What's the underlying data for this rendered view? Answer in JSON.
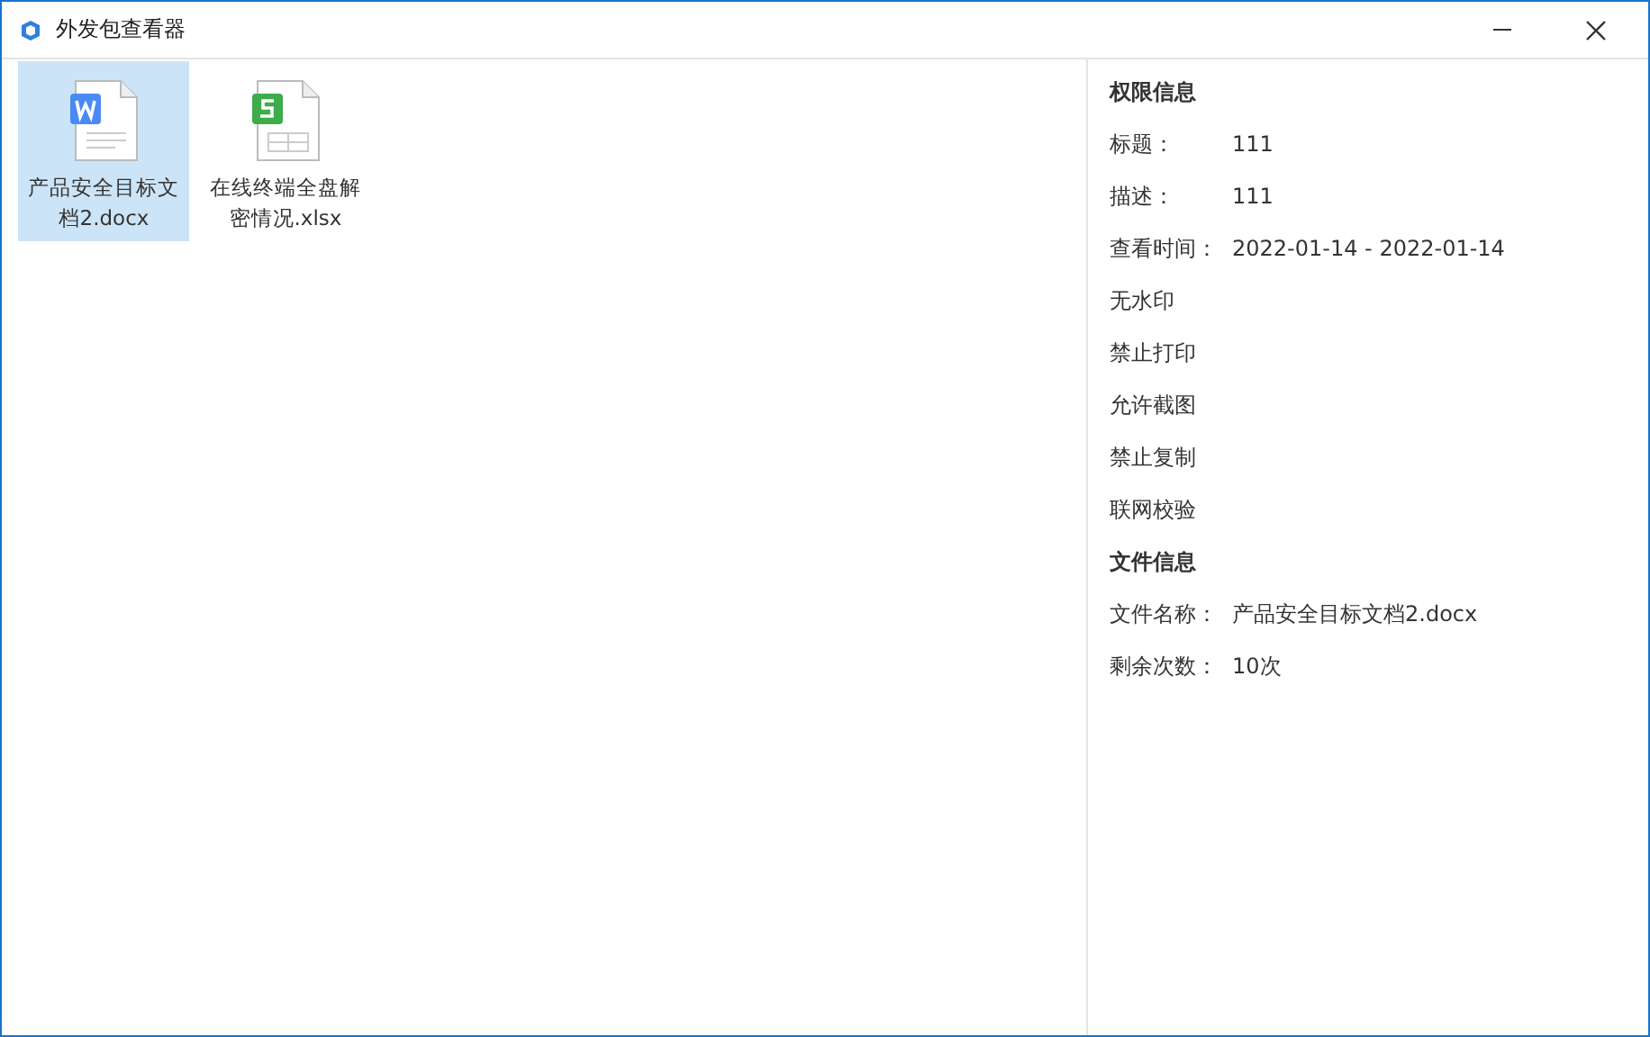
{
  "window": {
    "title": "外发包查看器"
  },
  "files": [
    {
      "name": "产品安全目标文档2.docx",
      "kind": "word",
      "selected": true
    },
    {
      "name": "在线终端全盘解密情况.xlsx",
      "kind": "sheet",
      "selected": false
    }
  ],
  "sections": [
    {
      "heading": "权限信息",
      "rows": [
        {
          "kind": "pair",
          "label": "标题：",
          "value": "111"
        },
        {
          "kind": "pair",
          "label": "描述：",
          "value": "111"
        },
        {
          "kind": "pair",
          "label": "查看时间：",
          "value": "2022-01-14 - 2022-01-14"
        },
        {
          "kind": "plain",
          "text": "无水印"
        },
        {
          "kind": "plain",
          "text": "禁止打印"
        },
        {
          "kind": "plain",
          "text": "允许截图"
        },
        {
          "kind": "plain",
          "text": "禁止复制"
        },
        {
          "kind": "plain",
          "text": "联网校验"
        }
      ]
    },
    {
      "heading": "文件信息",
      "rows": [
        {
          "kind": "pair",
          "label": "文件名称：",
          "value": "产品安全目标文档2.docx"
        },
        {
          "kind": "pair",
          "label": "剩余次数：",
          "value": "10次"
        }
      ]
    }
  ]
}
